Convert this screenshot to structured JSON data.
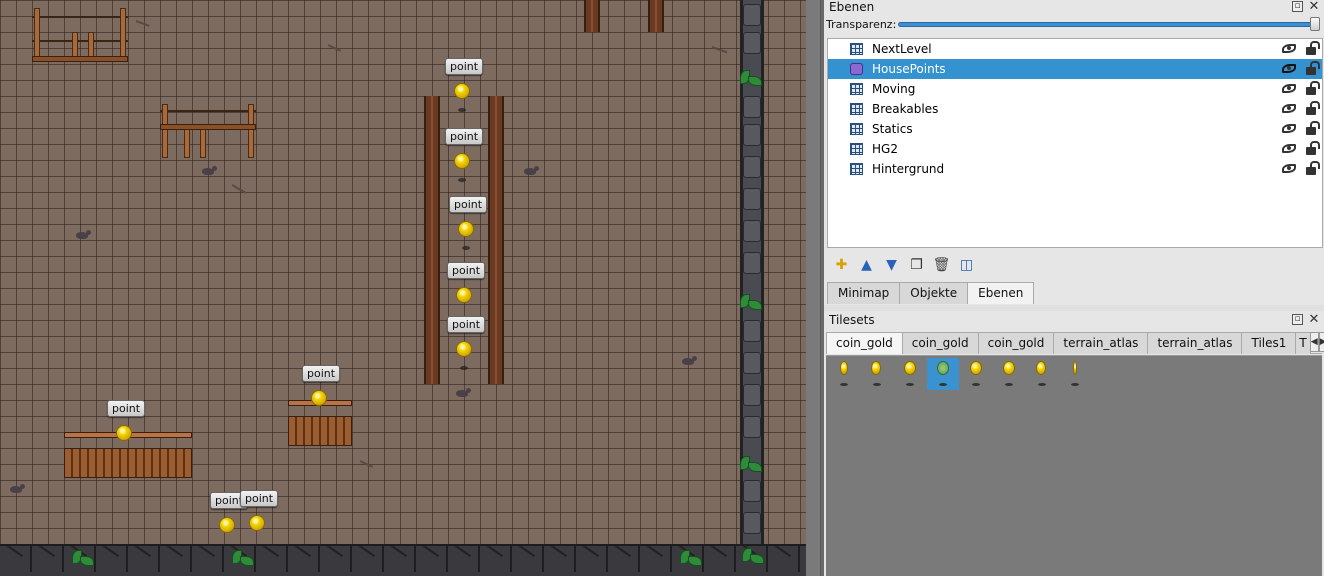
{
  "map": {
    "object_label": "point"
  },
  "layers_panel": {
    "title": "Ebenen",
    "opacity_label": "Transparenz:",
    "opacity_value": 1.0,
    "layers": [
      {
        "name": "NextLevel",
        "kind": "tile",
        "selected": false,
        "visible": true,
        "locked": false
      },
      {
        "name": "HousePoints",
        "kind": "object",
        "selected": true,
        "visible": true,
        "locked": false
      },
      {
        "name": "Moving",
        "kind": "tile",
        "selected": false,
        "visible": true,
        "locked": false
      },
      {
        "name": "Breakables",
        "kind": "tile",
        "selected": false,
        "visible": true,
        "locked": false
      },
      {
        "name": "Statics",
        "kind": "tile",
        "selected": false,
        "visible": true,
        "locked": false
      },
      {
        "name": "HG2",
        "kind": "tile",
        "selected": false,
        "visible": true,
        "locked": false
      },
      {
        "name": "Hintergrund",
        "kind": "tile",
        "selected": false,
        "visible": true,
        "locked": false
      }
    ],
    "toolbar": [
      "new-layer-icon",
      "move-up-icon",
      "move-down-icon",
      "duplicate-icon",
      "delete-icon",
      "layers-icon"
    ]
  },
  "bottom_tabs": [
    "Minimap",
    "Objekte",
    "Ebenen"
  ],
  "bottom_tabs_active": 2,
  "tilesets_panel": {
    "title": "Tilesets",
    "tabs": [
      "coin_gold",
      "coin_gold",
      "coin_gold",
      "terrain_atlas",
      "terrain_atlas",
      "Tiles1",
      "T"
    ],
    "active_tab": 0,
    "selected_tile": 3,
    "tile_count": 8
  },
  "colors": {
    "selection": "#3592d0",
    "coin": "#f4d40a",
    "ground_tile": "#7d6b60"
  }
}
